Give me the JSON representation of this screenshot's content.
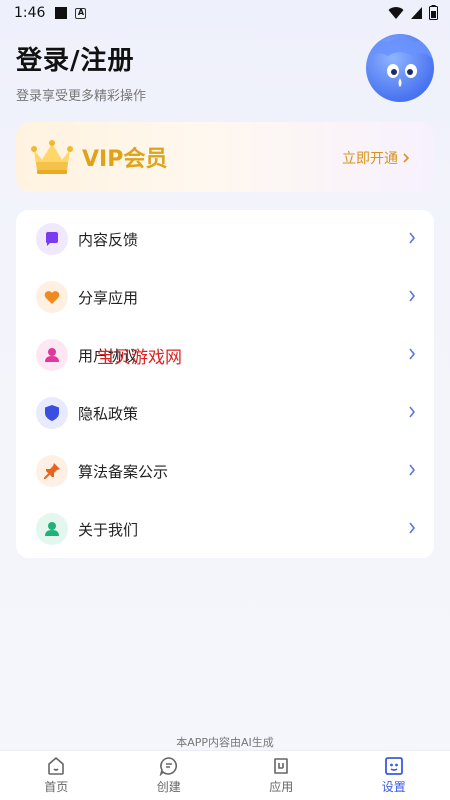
{
  "status_bar": {
    "time": "1:46"
  },
  "header": {
    "title": "登录/注册",
    "subtitle": "登录享受更多精彩操作"
  },
  "vip": {
    "label": "VIP会员",
    "action": "立即开通"
  },
  "menu": {
    "items": [
      {
        "label": "内容反馈",
        "icon": "message-icon",
        "color": "#7a3cf0",
        "bg": "#efe8ff"
      },
      {
        "label": "分享应用",
        "icon": "heart-icon",
        "color": "#f08a1e",
        "bg": "#fff0e2"
      },
      {
        "label": "用户协议",
        "icon": "user-icon",
        "color": "#e0379b",
        "bg": "#ffe6f3"
      },
      {
        "label": "隐私政策",
        "icon": "shield-icon",
        "color": "#3a4fe0",
        "bg": "#e8ebff"
      },
      {
        "label": "算法备案公示",
        "icon": "pin-icon",
        "color": "#e8631e",
        "bg": "#fff0e6"
      },
      {
        "label": "关于我们",
        "icon": "person-icon",
        "color": "#22b07a",
        "bg": "#e3f7ee"
      }
    ]
  },
  "watermark": "宝贝游戏网",
  "footnote": "本APP内容由AI生成",
  "tabs": [
    {
      "label": "首页",
      "icon": "home-icon"
    },
    {
      "label": "创建",
      "icon": "chat-icon"
    },
    {
      "label": "应用",
      "icon": "apps-icon"
    },
    {
      "label": "设置",
      "icon": "settings-icon"
    }
  ],
  "colors": {
    "accent": "#3a5be6",
    "vip_gold": "#e0a219"
  }
}
